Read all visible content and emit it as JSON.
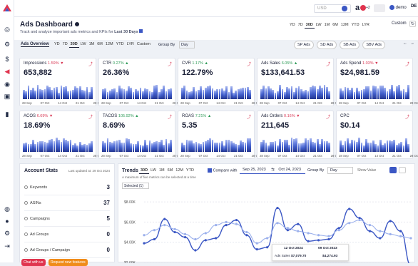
{
  "topbar": {
    "currency": "USD",
    "badge_count": "+2",
    "profile_name": "demo",
    "region": "DE"
  },
  "header": {
    "title": "Ads Dashboard",
    "subtitle_prefix": "Track and analyze important ads metrics and KPIs for",
    "subtitle_period": "Last 30 Days",
    "ranges": [
      "YD",
      "7D",
      "30D",
      "LW",
      "1M",
      "6M",
      "12M",
      "YTD",
      "LYR",
      "Custom"
    ],
    "active_range": "30D"
  },
  "overview": {
    "tab_label": "Ads Overview",
    "ranges": [
      "YD",
      "7D",
      "30D",
      "LW",
      "1M",
      "6M",
      "12M",
      "YTD",
      "LYR",
      "Custom"
    ],
    "group_by_label": "Group By",
    "group_by_value": "Day",
    "ad_types": [
      "SP Ads",
      "SD Ads",
      "SB Ads",
      "SBV Ads"
    ]
  },
  "axis_dates": [
    "28 Sep",
    "07 Oct",
    "14 Oct",
    "21 Oct",
    "28 Oct"
  ],
  "metrics": [
    {
      "label": "Impressions",
      "change": "1.59%",
      "dir": "down",
      "value": "653,882"
    },
    {
      "label": "CTR",
      "change": "0.27%",
      "dir": "up",
      "value": "26.36%"
    },
    {
      "label": "CVR",
      "change": "1.17%",
      "dir": "up",
      "value": "122.79%"
    },
    {
      "label": "Ads Sales",
      "change": "6.05%",
      "dir": "up",
      "value": "$133,641.53"
    },
    {
      "label": "Ads Spend",
      "change": "1.03%",
      "dir": "down",
      "value": "$24,981.59"
    },
    {
      "label": "ACOS",
      "change": "6.69%",
      "dir": "down",
      "value": "18.69%"
    },
    {
      "label": "TACOS",
      "change": "105.92%",
      "dir": "up",
      "value": "8.69%"
    },
    {
      "label": "ROAS",
      "change": "7.21%",
      "dir": "up",
      "value": "5.35"
    },
    {
      "label": "Ads Orders",
      "change": "0.16%",
      "dir": "down",
      "value": "211,645"
    },
    {
      "label": "CPC",
      "change": "",
      "dir": "",
      "value": "$0.14"
    }
  ],
  "account_stats": {
    "title": "Account Stats",
    "updated": "Last updated at: 29 Oct 2024",
    "rows": [
      {
        "label": "Keywords",
        "value": "3"
      },
      {
        "label": "ASINs",
        "value": "37"
      },
      {
        "label": "Campaigns",
        "value": "5"
      },
      {
        "label": "Ad Groups",
        "value": "0"
      },
      {
        "label": "Ad Groups / Campaign",
        "value": "0"
      }
    ],
    "chat_button": "Chat with us",
    "request_button": "Request new features"
  },
  "trends": {
    "title": "Trends",
    "ranges": [
      "30D",
      "LW",
      "1M",
      "6M",
      "12M",
      "YTD"
    ],
    "compare_label": "Compare with",
    "date_from": "Sep 25, 2023",
    "date_to": "Oct 24, 2023",
    "group_by_label": "Group By",
    "group_by_value": "Day",
    "show_value": "Show Value",
    "note": "A maximum of five metrics can be selected at a time",
    "selected": "Selected (1)",
    "tooltip": {
      "date1": "12 Oct 2024",
      "date2": "09 Oct 2023",
      "metric": "Ads Sales",
      "v1": "$7,079.70",
      "v2": "$4,274.93"
    }
  },
  "colors": {
    "accent": "#3b57c4",
    "up": "#2e9b58",
    "down": "#d93b57",
    "chat": "#e0344e",
    "request": "#f08c1a"
  },
  "chart_data": {
    "type": "line",
    "ylabel": "",
    "y_ticks": [
      "$8.00K",
      "$6.00K",
      "$4.00K",
      "$2.00K"
    ],
    "ylim": [
      2000,
      8500
    ],
    "series": [
      {
        "name": "Ads Sales",
        "values": [
          3900,
          4300,
          6300,
          5000,
          4500,
          3200,
          4200,
          4400,
          5700,
          6200,
          4700,
          3300,
          3500,
          7400,
          5200,
          5800,
          4100,
          4200,
          4300,
          5400,
          7300,
          6400,
          5100,
          4400,
          6100,
          5100,
          1700
        ]
      },
      {
        "values": [
          4700,
          5200,
          5700,
          5300,
          4800,
          4300,
          4900,
          5700,
          6000,
          5800,
          5000,
          3900,
          4400,
          5900,
          5400,
          5100,
          4900,
          4700,
          4600,
          5200,
          5900,
          6200,
          5700,
          5100,
          4800,
          4600,
          4400
        ]
      }
    ]
  }
}
